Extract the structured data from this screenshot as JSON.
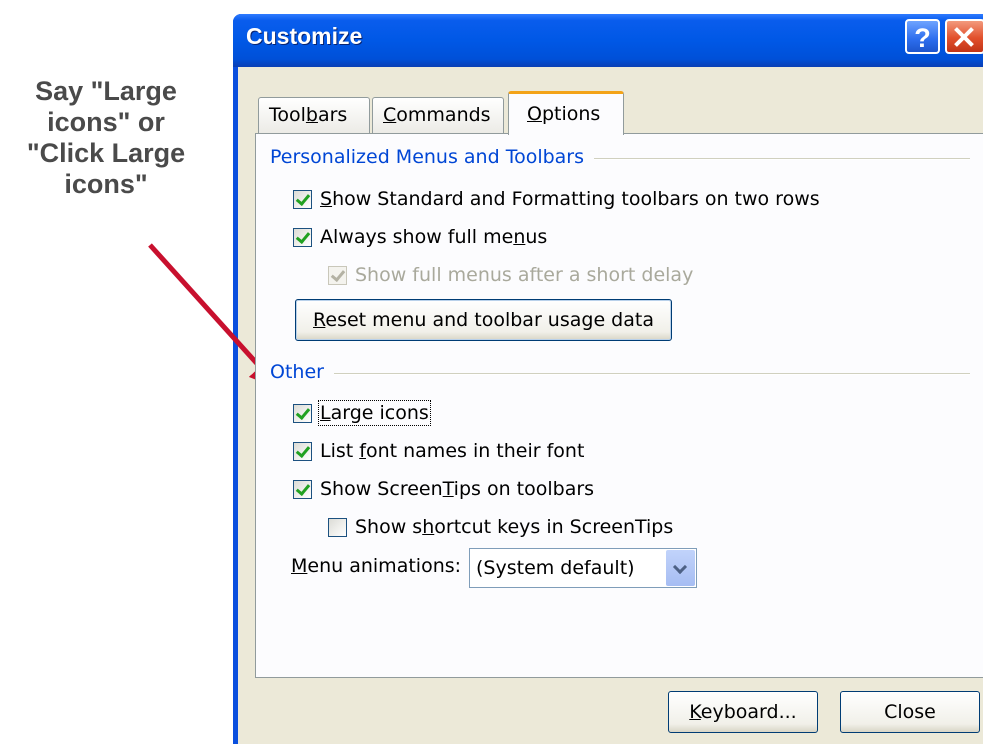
{
  "annotation": {
    "lines": [
      "Say \"Large",
      "icons\" or",
      "\"Click Large",
      "icons\""
    ]
  },
  "dialog": {
    "title": "Customize",
    "help_label": "?",
    "tabs": [
      {
        "label_pre": "Tool",
        "label_u": "b",
        "label_post": "ars",
        "active": false
      },
      {
        "label_pre": "",
        "label_u": "C",
        "label_post": "ommands",
        "active": false
      },
      {
        "label_pre": "",
        "label_u": "O",
        "label_post": "ptions",
        "active": true
      }
    ],
    "group1": {
      "title": "Personalized Menus and Toolbars",
      "items": [
        {
          "pre": "",
          "u": "S",
          "post": "how Standard and Formatting toolbars on two rows",
          "checked": true,
          "disabled": false
        },
        {
          "pre": "Always show full me",
          "u": "n",
          "post": "us",
          "checked": true,
          "disabled": false
        },
        {
          "pre": "Show full menus after a short delay",
          "u": "",
          "post": "",
          "checked": true,
          "disabled": true
        }
      ],
      "reset_button": {
        "pre": "",
        "u": "R",
        "post": "eset menu and toolbar usage data"
      }
    },
    "group2": {
      "title": "Other",
      "items": [
        {
          "pre": "",
          "u": "L",
          "post": "arge icons",
          "checked": true,
          "disabled": false,
          "focused": true
        },
        {
          "pre": "List ",
          "u": "f",
          "post": "ont names in their font",
          "checked": true,
          "disabled": false
        },
        {
          "pre": "Show Screen",
          "u": "T",
          "post": "ips on toolbars",
          "checked": true,
          "disabled": false
        },
        {
          "pre": "Show s",
          "u": "h",
          "post": "ortcut keys in ScreenTips",
          "checked": false,
          "disabled": false
        }
      ],
      "menu_animations": {
        "pre": "",
        "u": "M",
        "post": "enu animations:",
        "value": "(System default)"
      }
    },
    "keyboard_button": {
      "pre": "",
      "u": "K",
      "post": "eyboard..."
    },
    "close_button": "Close"
  },
  "colors": {
    "titlebar": "#0058e6",
    "group_title": "#0046d5",
    "arrow": "#c8102e",
    "tab_highlight": "#f3a318"
  }
}
